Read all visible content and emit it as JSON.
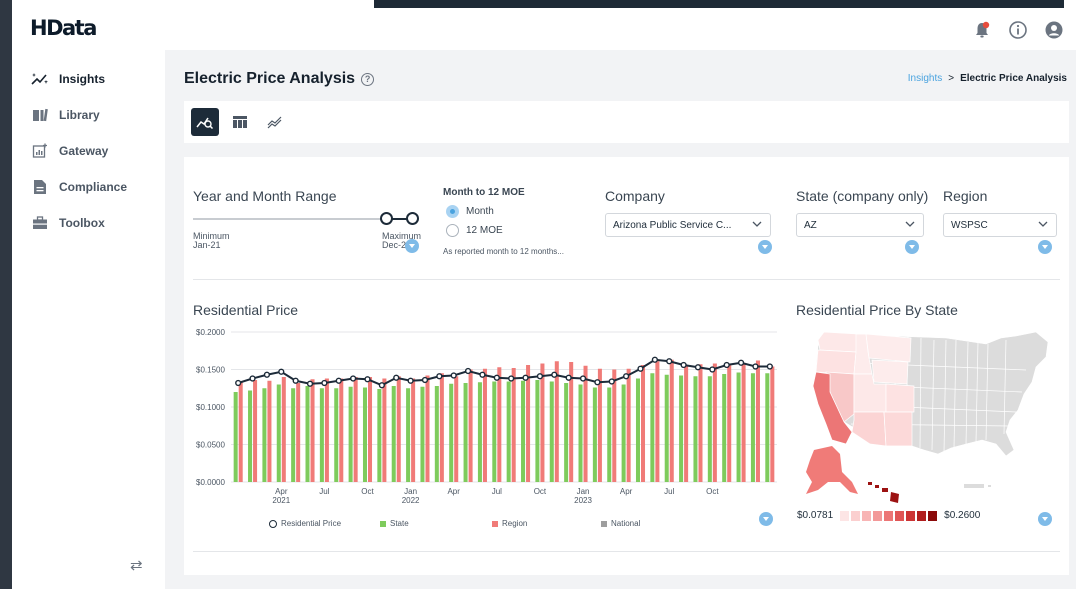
{
  "app": {
    "logo_text": "HData",
    "notification_dot_color": "#e74c3c",
    "icons": [
      "bell-icon",
      "info-icon",
      "user-icon"
    ]
  },
  "sidebar": {
    "items": [
      {
        "label": "Insights",
        "icon": "sparkle-chart-icon",
        "active": true
      },
      {
        "label": "Library",
        "icon": "book-icon",
        "active": false
      },
      {
        "label": "Gateway",
        "icon": "chart-add-icon",
        "active": false
      },
      {
        "label": "Compliance",
        "icon": "document-icon",
        "active": false
      },
      {
        "label": "Toolbox",
        "icon": "briefcase-icon",
        "active": false
      }
    ],
    "collapse_icon": "swap-arrows-icon"
  },
  "header": {
    "title": "Electric Price Analysis",
    "breadcrumb": {
      "link": "Insights",
      "separator": ">",
      "current": "Electric Price Analysis"
    }
  },
  "toolbar": {
    "views": [
      {
        "icon": "chart-search-icon",
        "active": true
      },
      {
        "icon": "table-icon",
        "active": false
      },
      {
        "icon": "trend-lines-icon",
        "active": false
      }
    ]
  },
  "filters": {
    "range": {
      "label": "Year and Month Range",
      "min_label": "Minimum",
      "min_value": "Jan-21",
      "max_label": "Maximum",
      "max_value": "Dec-2"
    },
    "moe": {
      "label": "Month to 12 MOE",
      "options": [
        "Month",
        "12 MOE"
      ],
      "selected": "Month",
      "note": "As reported month to 12 months..."
    },
    "company": {
      "label": "Company",
      "value": "Arizona Public Service C..."
    },
    "state": {
      "label": "State (company only)",
      "value": "AZ"
    },
    "region": {
      "label": "Region",
      "value": "WSPSC"
    }
  },
  "colors": {
    "accent": "#4aa3df",
    "dark": "#1d2b39",
    "state": "#7ecb5c",
    "region": "#f07b78",
    "national": "#9e9e9e",
    "filter_dot": "#7fbbe8"
  },
  "chart_data": [
    {
      "type": "bar",
      "title": "Residential Price",
      "y_tick_labels": [
        "$0.2000",
        "$0.1500",
        "$0.1000",
        "$0.0500",
        "$0.0000"
      ],
      "ylim": [
        0,
        0.2
      ],
      "y_ticks": [
        0,
        0.05,
        0.1,
        0.15,
        0.2
      ],
      "x_tick_labels": [
        {
          "index": 3,
          "label": "Apr",
          "year": "2021"
        },
        {
          "index": 6,
          "label": "Jul"
        },
        {
          "index": 9,
          "label": "Oct"
        },
        {
          "index": 12,
          "label": "Jan",
          "year": "2022"
        },
        {
          "index": 15,
          "label": "Apr"
        },
        {
          "index": 18,
          "label": "Jul"
        },
        {
          "index": 21,
          "label": "Oct"
        },
        {
          "index": 24,
          "label": "Jan",
          "year": "2023"
        },
        {
          "index": 27,
          "label": "Apr"
        },
        {
          "index": 30,
          "label": "Jul"
        },
        {
          "index": 33,
          "label": "Oct"
        }
      ],
      "legend": [
        "Residential Price",
        "State",
        "Region",
        "National"
      ],
      "series": [
        {
          "name": "Residential Price",
          "kind": "line",
          "values": [
            0.132,
            0.138,
            0.143,
            0.147,
            0.135,
            0.131,
            0.132,
            0.135,
            0.138,
            0.137,
            0.129,
            0.139,
            0.135,
            0.136,
            0.141,
            0.142,
            0.148,
            0.143,
            0.139,
            0.138,
            0.139,
            0.141,
            0.143,
            0.139,
            0.138,
            0.133,
            0.134,
            0.141,
            0.151,
            0.163,
            0.161,
            0.156,
            0.153,
            0.15,
            0.156,
            0.159,
            0.154,
            0.154
          ]
        },
        {
          "name": "State",
          "kind": "bar",
          "values": [
            0.12,
            0.122,
            0.125,
            0.13,
            0.125,
            0.128,
            0.125,
            0.125,
            0.127,
            0.126,
            0.124,
            0.128,
            0.125,
            0.127,
            0.128,
            0.131,
            0.132,
            0.133,
            0.134,
            0.134,
            0.135,
            0.136,
            0.134,
            0.132,
            0.13,
            0.126,
            0.126,
            0.13,
            0.138,
            0.145,
            0.143,
            0.142,
            0.141,
            0.141,
            0.144,
            0.146,
            0.145,
            0.145
          ]
        },
        {
          "name": "Region",
          "kind": "bar",
          "values": [
            0.133,
            0.136,
            0.135,
            0.14,
            0.132,
            0.137,
            0.138,
            0.138,
            0.14,
            0.14,
            0.138,
            0.141,
            0.138,
            0.142,
            0.145,
            0.141,
            0.15,
            0.151,
            0.153,
            0.152,
            0.156,
            0.158,
            0.161,
            0.16,
            0.155,
            0.151,
            0.15,
            0.151,
            0.156,
            0.161,
            0.163,
            0.156,
            0.157,
            0.158,
            0.156,
            0.157,
            0.162,
            0.154
          ]
        }
      ]
    },
    {
      "type": "choropleth",
      "title": "Residential Price By State",
      "scale_min_label": "$0.0781",
      "scale_max_label": "$0.2600",
      "scale_colors": [
        "#fde5e5",
        "#fbcfcf",
        "#f8b5b5",
        "#f39898",
        "#ec7676",
        "#e05555",
        "#cc3434",
        "#b11d1d",
        "#8b0a0a"
      ],
      "highlighted_states": [
        {
          "state": "CA",
          "color": "#ec7676"
        },
        {
          "state": "AK",
          "color": "#f07b78"
        },
        {
          "state": "HI",
          "color": "#9c1212"
        },
        {
          "state": "NV",
          "color": "#f8c8c8"
        },
        {
          "state": "AZ",
          "color": "#fbd4d4"
        },
        {
          "state": "OR",
          "color": "#fde2e2"
        },
        {
          "state": "WA",
          "color": "#fde8e8"
        },
        {
          "state": "NM",
          "color": "#fcd9d9"
        },
        {
          "state": "UT",
          "color": "#fde8e8"
        },
        {
          "state": "ID",
          "color": "#fdecec"
        },
        {
          "state": "MT",
          "color": "#fdecec"
        },
        {
          "state": "WY",
          "color": "#fdecec"
        },
        {
          "state": "CO",
          "color": "#fde2e2"
        }
      ]
    }
  ]
}
